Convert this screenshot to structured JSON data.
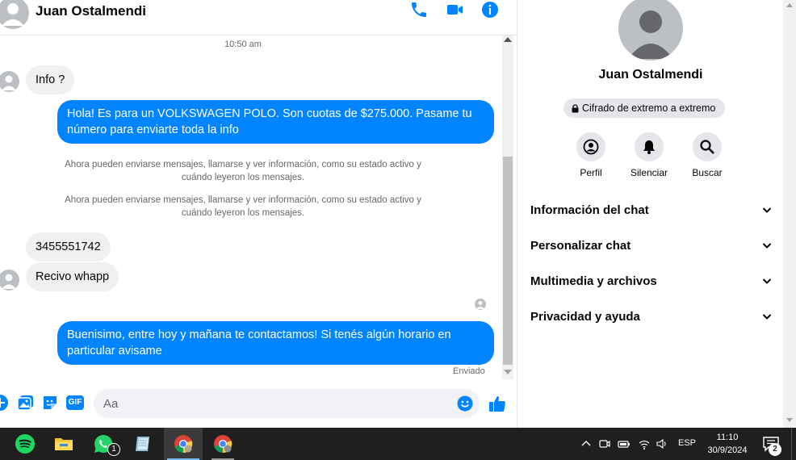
{
  "header": {
    "contact_name": "Juan Ostalmendi",
    "icons": [
      "phone-icon",
      "video-icon",
      "info-icon"
    ],
    "accent_color": "#0084ff"
  },
  "messages": {
    "timestamp": "10:50 am",
    "items": [
      {
        "direction": "in",
        "text": "Info ?"
      },
      {
        "direction": "out",
        "text": "Hola! Es para un VOLKSWAGEN POLO. Son cuotas de $275.000. Pasame tu número para enviarte toda la info"
      },
      {
        "direction": "system",
        "text": "Ahora pueden enviarse mensajes, llamarse y ver información, como su estado activo y cuándo leyeron los mensajes."
      },
      {
        "direction": "system",
        "text": "Ahora pueden enviarse mensajes, llamarse y ver información, como su estado activo y cuándo leyeron los mensajes."
      },
      {
        "direction": "in",
        "text": "3455551742"
      },
      {
        "direction": "in",
        "text": "Recivo whapp"
      },
      {
        "direction": "out",
        "text": "Buenisimo, entre hoy y mañana te contactamos! Si tenés algún horario en particular avisame"
      }
    ],
    "status": "Enviado"
  },
  "composer": {
    "placeholder": "Aa",
    "icons": [
      "plus-icon",
      "image-icon",
      "sticker-icon",
      "gif-icon",
      "emoji-icon",
      "like-icon"
    ],
    "gif_label": "GIF"
  },
  "panel": {
    "name": "Juan Ostalmendi",
    "encryption": "Cifrado de extremo a extremo",
    "actions": [
      {
        "label": "Perfil",
        "icon": "profile-icon"
      },
      {
        "label": "Silenciar",
        "icon": "bell-icon"
      },
      {
        "label": "Buscar",
        "icon": "search-icon"
      }
    ],
    "sections": [
      {
        "label": "Información del chat"
      },
      {
        "label": "Personalizar chat"
      },
      {
        "label": "Multimedia y archivos"
      },
      {
        "label": "Privacidad y ayuda"
      }
    ]
  },
  "taskbar": {
    "apps": [
      "spotify-icon",
      "file-explorer-icon",
      "whatsapp-icon",
      "notes-icon",
      "chrome-icon",
      "chrome-icon"
    ],
    "whatsapp_badge": "1",
    "language": "ESP",
    "time": "11:10",
    "date": "30/9/2024",
    "notification_count": "2"
  }
}
